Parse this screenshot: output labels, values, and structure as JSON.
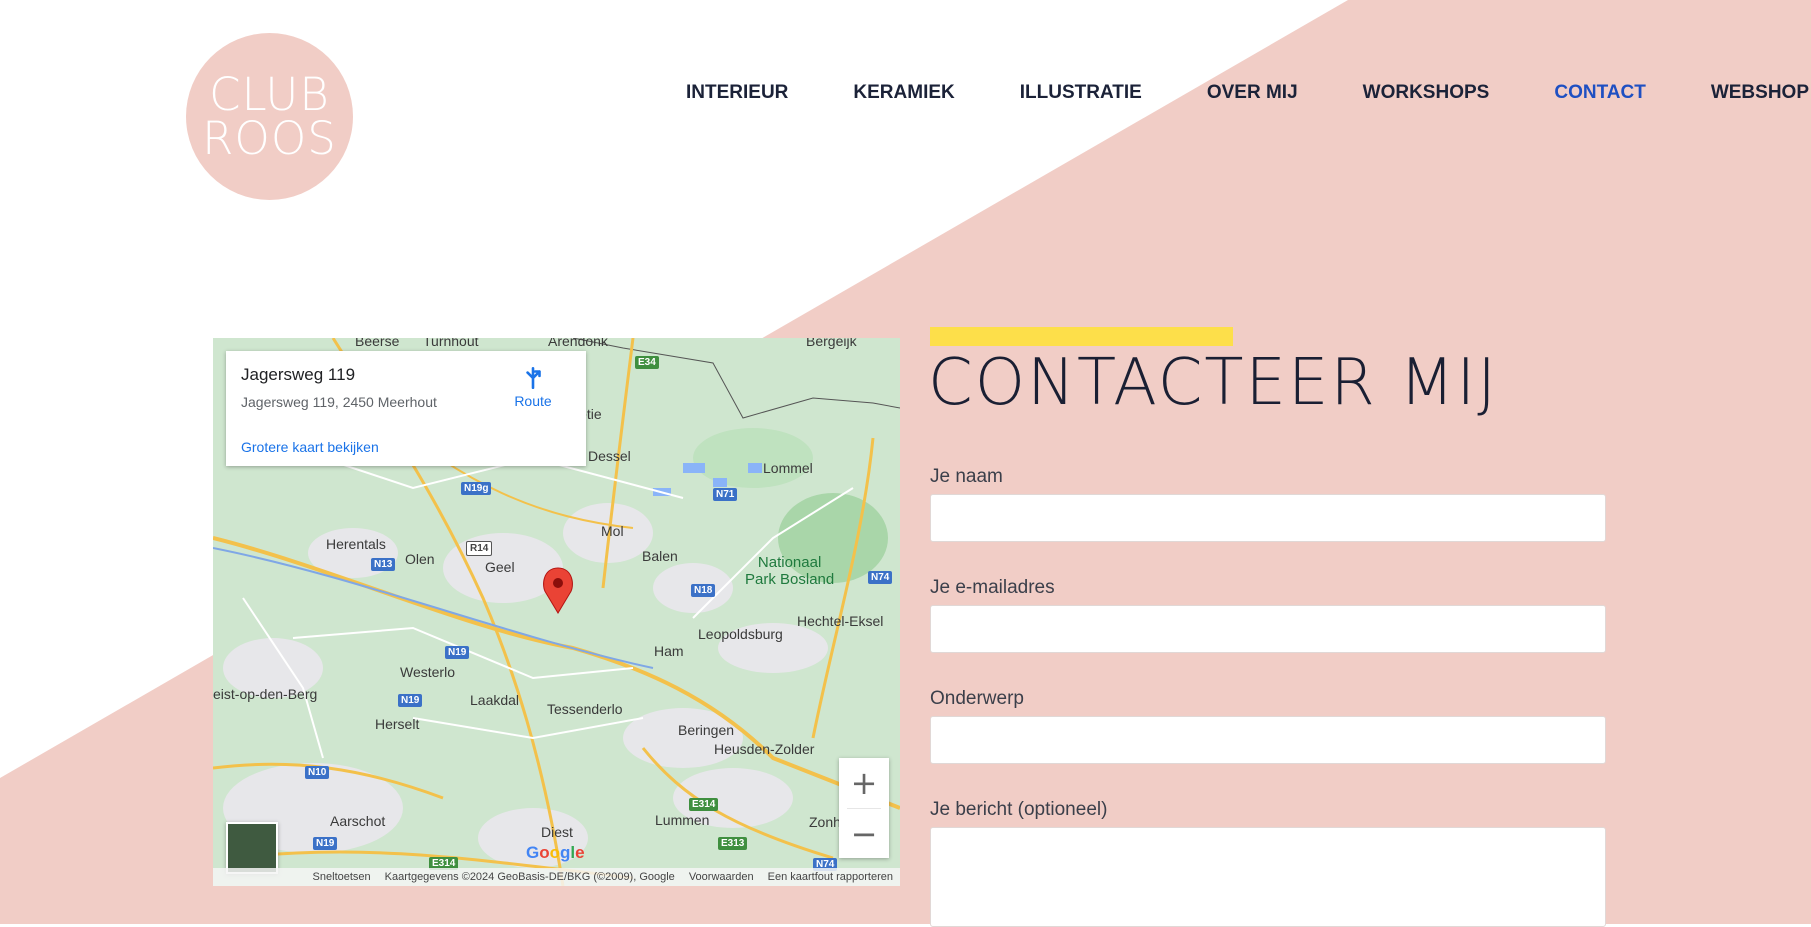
{
  "logo": {
    "line1": "CLUB",
    "line2": "ROOS"
  },
  "nav": {
    "items": [
      {
        "label": "INTERIEUR",
        "active": false
      },
      {
        "label": "KERAMIEK",
        "active": false
      },
      {
        "label": "ILLUSTRATIE",
        "active": false
      },
      {
        "label": "OVER MIJ",
        "active": false
      },
      {
        "label": "WORKSHOPS",
        "active": false
      },
      {
        "label": "CONTACT",
        "active": true
      },
      {
        "label": "WEBSHOP",
        "active": false
      }
    ]
  },
  "colors": {
    "pink": "#f1cdc6",
    "accent_yellow": "#fddf4a",
    "nav_active": "#1e4fc2",
    "nav_text": "#1b2238"
  },
  "map": {
    "place_card": {
      "title": "Jagersweg 119",
      "address": "Jagersweg 119, 2450 Meerhout",
      "route_label": "Route",
      "bigger_map_link": "Grotere kaart bekijken"
    },
    "zoom_in": "+",
    "zoom_out": "−",
    "google_logo": "Google",
    "footer": {
      "shortcuts": "Sneltoetsen",
      "map_data": "Kaartgegevens ©2024 GeoBasis-DE/BKG (©2009), Google",
      "terms": "Voorwaarden",
      "report": "Een kaartfout rapporteren"
    },
    "places": [
      "Beerse",
      "Turnhout",
      "Arendonk",
      "Bergeijk",
      "Retie",
      "Dessel",
      "Lommel",
      "Herentals",
      "Olen",
      "Geel",
      "Mol",
      "Balen",
      "Nationaal",
      "Park Bosland",
      "Hechtel-Eksel",
      "Leopoldsburg",
      "Ham",
      "Westerlo",
      "eist-op-den-Berg",
      "Laakdal",
      "Tessenderlo",
      "Herselt",
      "Beringen",
      "Heusden-Zolder",
      "Aarschot",
      "Diest",
      "Lummen",
      "Zonh"
    ],
    "roads": [
      "E34",
      "N19g",
      "N71",
      "R14",
      "N13",
      "N74",
      "N18",
      "N19",
      "N19",
      "N10",
      "N19",
      "E314",
      "E313",
      "E314",
      "N74"
    ]
  },
  "contact": {
    "title": "CONTACTEER MIJ",
    "fields": [
      {
        "label": "Je naam",
        "value": ""
      },
      {
        "label": "Je e-mailadres",
        "value": ""
      },
      {
        "label": "Onderwerp",
        "value": ""
      },
      {
        "label": "Je bericht (optioneel)",
        "value": ""
      }
    ]
  }
}
